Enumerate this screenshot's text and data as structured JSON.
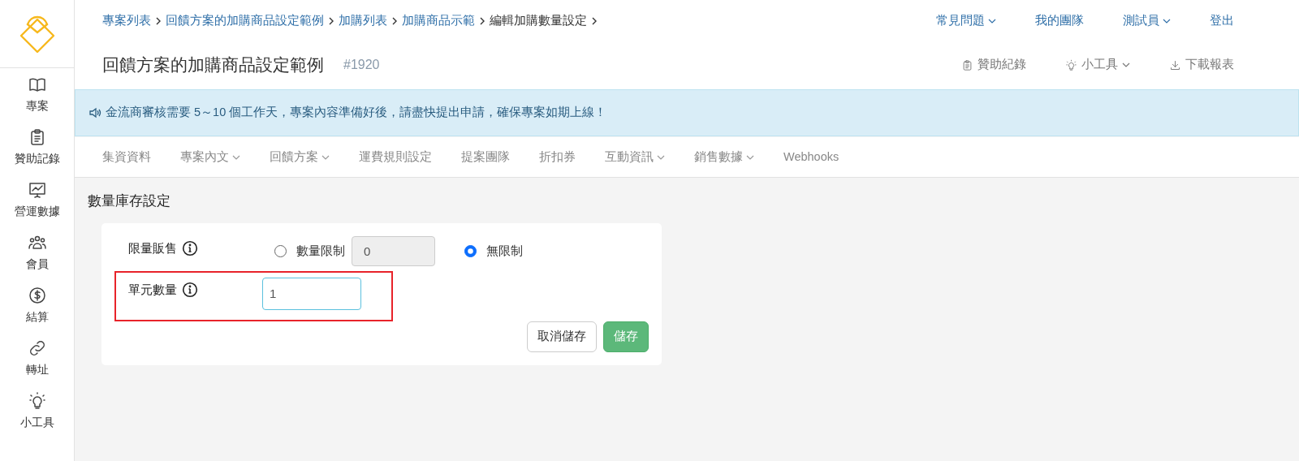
{
  "sidebar": {
    "items": [
      {
        "kind": "book",
        "label": "專案"
      },
      {
        "kind": "clipboard",
        "label": "贊助記錄"
      },
      {
        "kind": "chart",
        "label": "營運數據"
      },
      {
        "kind": "people",
        "label": "會員"
      },
      {
        "kind": "dollar",
        "label": "結算"
      },
      {
        "kind": "link",
        "label": "轉址"
      },
      {
        "kind": "bulb",
        "label": "小工具"
      }
    ]
  },
  "breadcrumb": [
    {
      "label": "專案列表",
      "link": true
    },
    {
      "label": "回饋方案的加購商品設定範例",
      "link": true
    },
    {
      "label": "加購列表",
      "link": true
    },
    {
      "label": "加購商品示範",
      "link": true
    },
    {
      "label": "編輯加購數量設定",
      "link": false
    }
  ],
  "top_menu": [
    {
      "label": "常見問題",
      "dropdown": true
    },
    {
      "label": "我的團隊",
      "dropdown": false
    },
    {
      "label": "測試員",
      "dropdown": true
    },
    {
      "label": "登出",
      "dropdown": false
    }
  ],
  "page_title": "回饋方案的加購商品設定範例",
  "project_id": "#1920",
  "tools": [
    {
      "kind": "clipboard",
      "label": "贊助紀錄",
      "dropdown": false
    },
    {
      "kind": "bulb",
      "label": "小工具",
      "dropdown": true
    },
    {
      "kind": "download",
      "label": "下載報表",
      "dropdown": false
    }
  ],
  "notice": "金流商審核需要 5～10 個工作天，專案內容準備好後，請盡快提出申請，確保專案如期上線！",
  "tabs": [
    {
      "label": "集資資料",
      "dropdown": false,
      "selected": false
    },
    {
      "label": "專案內文",
      "dropdown": true,
      "selected": false
    },
    {
      "label": "回饋方案",
      "dropdown": true,
      "selected": false
    },
    {
      "label": "運費規則設定",
      "dropdown": false,
      "selected": false
    },
    {
      "label": "提案團隊",
      "dropdown": false,
      "selected": false
    },
    {
      "label": "折扣券",
      "dropdown": false,
      "selected": false
    },
    {
      "label": "互動資訊",
      "dropdown": true,
      "selected": false
    },
    {
      "label": "銷售數據",
      "dropdown": true,
      "selected": false
    },
    {
      "label": "Webhooks",
      "dropdown": false,
      "selected": false
    }
  ],
  "section_title": "數量庫存設定",
  "form": {
    "limit": {
      "label": "限量販售",
      "options": [
        {
          "label": "數量限制",
          "selected": false,
          "value": "0"
        },
        {
          "label": "無限制",
          "selected": true
        }
      ]
    },
    "unit": {
      "label": "單元數量",
      "value": "1",
      "highlighted": true
    },
    "buttons": [
      {
        "label": "取消儲存",
        "kind": "secondary"
      },
      {
        "label": "儲存",
        "kind": "primary"
      }
    ]
  }
}
